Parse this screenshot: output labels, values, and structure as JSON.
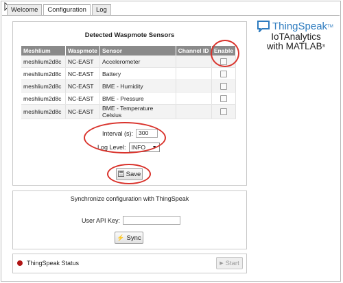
{
  "tabs": [
    "Welcome",
    "Configuration",
    "Log"
  ],
  "active_tab": "Configuration",
  "sensors_panel": {
    "title": "Detected Waspmote Sensors",
    "columns": [
      "Meshlium",
      "Waspmote",
      "Sensor",
      "Channel ID",
      "Enable"
    ],
    "rows": [
      {
        "meshlium": "meshlium2d8c",
        "waspmote": "NC-EAST",
        "sensor": "Accelerometer",
        "channel_id": "",
        "enabled": false
      },
      {
        "meshlium": "meshlium2d8c",
        "waspmote": "NC-EAST",
        "sensor": "Battery",
        "channel_id": "",
        "enabled": false
      },
      {
        "meshlium": "meshlium2d8c",
        "waspmote": "NC-EAST",
        "sensor": "BME - Humidity",
        "channel_id": "",
        "enabled": false
      },
      {
        "meshlium": "meshlium2d8c",
        "waspmote": "NC-EAST",
        "sensor": "BME - Pressure",
        "channel_id": "",
        "enabled": false
      },
      {
        "meshlium": "meshlium2d8c",
        "waspmote": "NC-EAST",
        "sensor": "BME - Temperature Celsius",
        "channel_id": "",
        "enabled": false
      }
    ]
  },
  "settings": {
    "interval_label": "Interval (s):",
    "interval_value": "300",
    "log_level_label": "Log Level:",
    "log_level_value": "INFO",
    "save_label": "Save"
  },
  "sync": {
    "title": "Synchronize configuration with ThingSpeak",
    "api_key_label": "User API Key:",
    "api_key_value": "",
    "sync_label": "Sync"
  },
  "status": {
    "label": "ThingSpeak Status",
    "indicator_color": "#b01515",
    "start_label": "Start"
  },
  "logo": {
    "name": "ThingSpeak",
    "tm": "TM",
    "line1": "IoTAnalytics",
    "line2": "with MATLAB",
    "reg": "®",
    "color": "#2d7bbf"
  },
  "icons": {
    "save": "floppy-disk-icon",
    "sync": "lightning-icon",
    "start": "play-icon",
    "logo": "chat-bubble-icon"
  },
  "highlight_color": "#d9322b"
}
